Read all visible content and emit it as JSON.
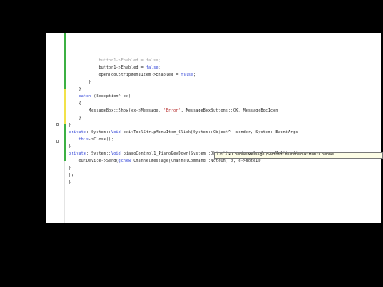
{
  "editor": {
    "lines": [
      {
        "id": "l1",
        "text": "            button1->Enabled = false;",
        "faded": true
      },
      {
        "id": "l2",
        "text": "            button1->Enabled = false;"
      },
      {
        "id": "l3",
        "text": "            openToolStripMenuItem->Enabled = false;"
      },
      {
        "id": "l4",
        "text": "        }"
      },
      {
        "id": "l5",
        "text": "    }"
      },
      {
        "id": "l6",
        "text": "    catch (Exception^ ex)"
      },
      {
        "id": "l7",
        "text": "    {"
      },
      {
        "id": "l8",
        "text": "        MessageBox::Show(ex->Message, \"Error\", MessageBoxButtons::OK, MessageBoxIcon"
      },
      {
        "id": "l9",
        "text": "    }"
      },
      {
        "id": "l10",
        "text": "}"
      },
      {
        "id": "l11",
        "text": "private: System::Void exitToolStripMenuItem_Click(System::Object^  sender, System::EventArgs"
      },
      {
        "id": "l12",
        "text": "    this->Close();"
      },
      {
        "id": "l13",
        "text": "}"
      },
      {
        "id": "l14",
        "text": "private: System::Void pianoControl1_PianoKeyDown(System::Object^  sender, Sanford::Multimedi"
      },
      {
        "id": "l15",
        "text": "    outDevice->Send(gcnew ChannelMessage(ChannelCommand::NoteOn, 0, e->NoteID"
      },
      {
        "id": "l16",
        "text": "}"
      },
      {
        "id": "l17",
        "text": "};"
      },
      {
        "id": "l18",
        "text": "}"
      }
    ]
  },
  "tooltip": {
    "nav": "1 of 2",
    "signature": "ChannelMessage (Sanford::Multimedia::Midi::Channel"
  },
  "colors": {
    "keyword": "#2b3fd6",
    "string": "#b22222",
    "change_bar_saved": "#3cb043",
    "change_bar_unsaved": "#f2e24a"
  }
}
